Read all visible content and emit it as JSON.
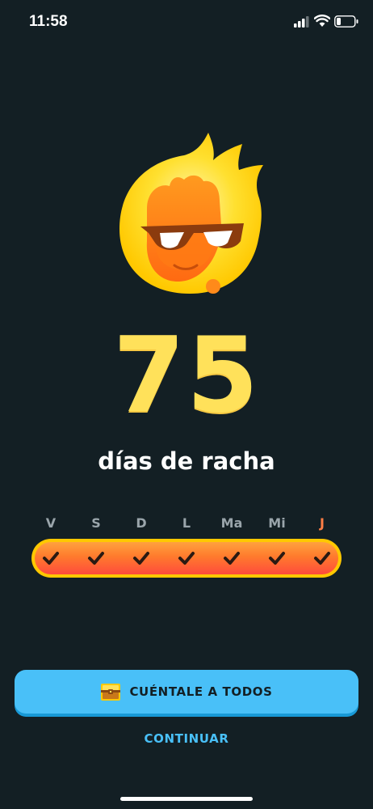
{
  "status_bar": {
    "time": "11:58",
    "icons": [
      "signal-icon",
      "wifi-icon",
      "battery-icon"
    ]
  },
  "mascot": {
    "icon": "flame-mascot-sunglasses-icon"
  },
  "streak": {
    "count": "75",
    "label": "días de racha"
  },
  "week": {
    "days": [
      {
        "label": "V",
        "completed": true,
        "today": false
      },
      {
        "label": "S",
        "completed": true,
        "today": false
      },
      {
        "label": "D",
        "completed": true,
        "today": false
      },
      {
        "label": "L",
        "completed": true,
        "today": false
      },
      {
        "label": "Ma",
        "completed": true,
        "today": false
      },
      {
        "label": "Mi",
        "completed": true,
        "today": false
      },
      {
        "label": "J",
        "completed": true,
        "today": true
      }
    ]
  },
  "actions": {
    "share_label": "CUÉNTALE A TODOS",
    "share_icon": "treasure-chest-icon",
    "continue_label": "CONTINUAR"
  },
  "colors": {
    "background": "#131f24",
    "streak_number": "#ffe15a",
    "today_day": "#ff7e45",
    "bar_border": "#ffc800",
    "button": "#49c0f8",
    "link": "#49c0f8"
  }
}
